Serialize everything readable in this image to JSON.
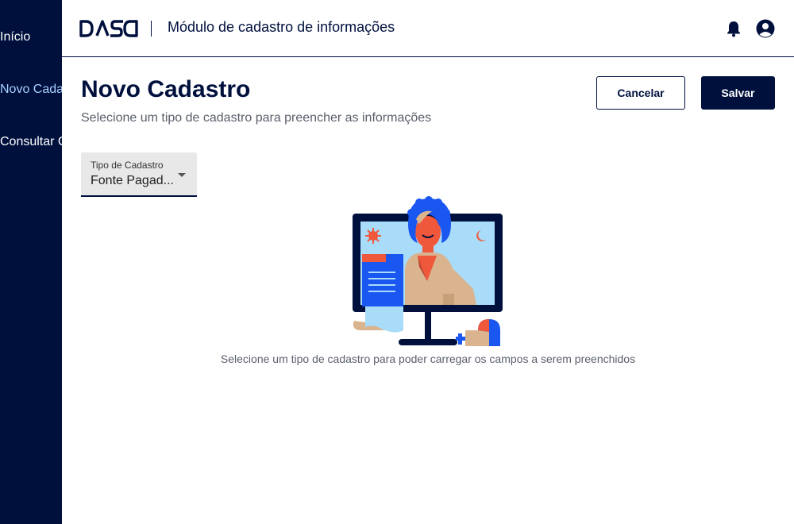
{
  "sidebar": {
    "items": [
      {
        "label": "Início",
        "active": false
      },
      {
        "label": "Novo Cadastro",
        "active": true
      },
      {
        "label": "Consultar Cadastros",
        "active": false
      }
    ]
  },
  "header": {
    "logo_text": "DASA",
    "app_title": "Módulo de cadastro de informações",
    "icons": [
      "bell-icon",
      "user-circle-icon"
    ]
  },
  "page": {
    "title": "Novo Cadastro",
    "subtitle": "Selecione um tipo de cadastro para preencher as informações",
    "cancel_label": "Cancelar",
    "save_label": "Salvar"
  },
  "form": {
    "tipo_cadastro": {
      "label": "Tipo de Cadastro",
      "value": "Fonte Pagad..."
    }
  },
  "empty_state": {
    "message": "Selecione um tipo de cadastro para poder carregar os campos a serem preenchidos"
  },
  "colors": {
    "brand_navy": "#00103d",
    "active_nav": "#a8d0ff",
    "illustration_blue": "#1a56f0",
    "illustration_red": "#f0583c",
    "illustration_sky": "#a9dcf9",
    "illustration_tan": "#d9b48f"
  }
}
